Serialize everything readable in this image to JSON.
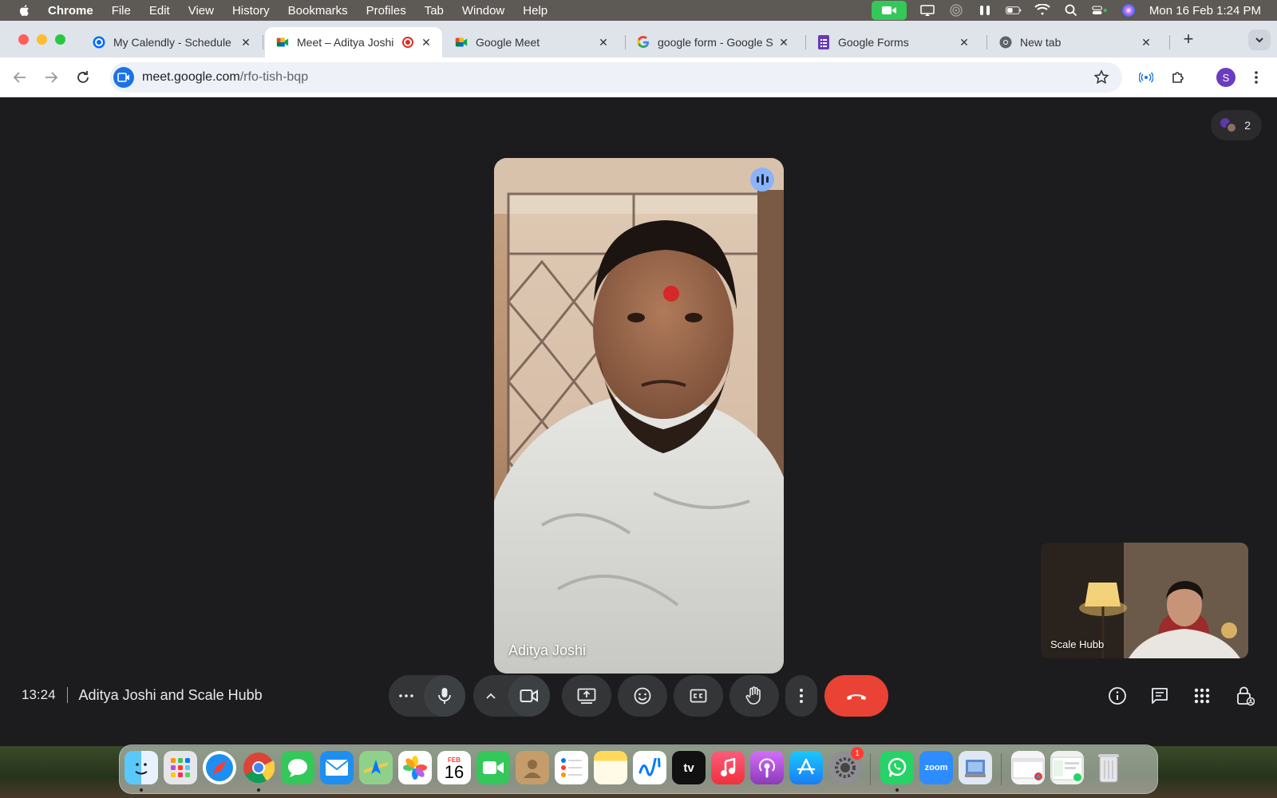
{
  "menubar": {
    "app": "Chrome",
    "items": [
      "File",
      "Edit",
      "View",
      "History",
      "Bookmarks",
      "Profiles",
      "Tab",
      "Window",
      "Help"
    ],
    "clock": "Mon 16 Feb  1:24 PM"
  },
  "tabs": [
    {
      "title": "My Calendly - Schedule",
      "favicon": "calendly-icon"
    },
    {
      "title": "Meet – Aditya Joshi",
      "favicon": "meet-icon",
      "active": true,
      "recording": true
    },
    {
      "title": "Google Meet",
      "favicon": "meet-icon"
    },
    {
      "title": "google form - Google S",
      "favicon": "google-icon"
    },
    {
      "title": "Google Forms",
      "favicon": "forms-icon"
    },
    {
      "title": "New tab",
      "favicon": "chrome-icon"
    }
  ],
  "toolbar": {
    "url_host": "meet.google.com",
    "url_path": "/rfo-tish-bqp",
    "profile_initial": "S"
  },
  "meet": {
    "participant_count": "2",
    "main_participant": "Aditya Joshi",
    "self_participant": "Scale Hubb",
    "elapsed": "13:24",
    "meeting_title": "Aditya Joshi and Scale Hubb"
  },
  "dock": {
    "calendar_month": "FEB",
    "calendar_day": "16",
    "settings_badge": "1",
    "zoom_label": "zoom",
    "tv_label": "tv"
  },
  "colors": {
    "meet_bg": "#1c1c1e",
    "end_call": "#ea4335",
    "speaking": "#8ab4f8",
    "facetime": "#34c759"
  }
}
